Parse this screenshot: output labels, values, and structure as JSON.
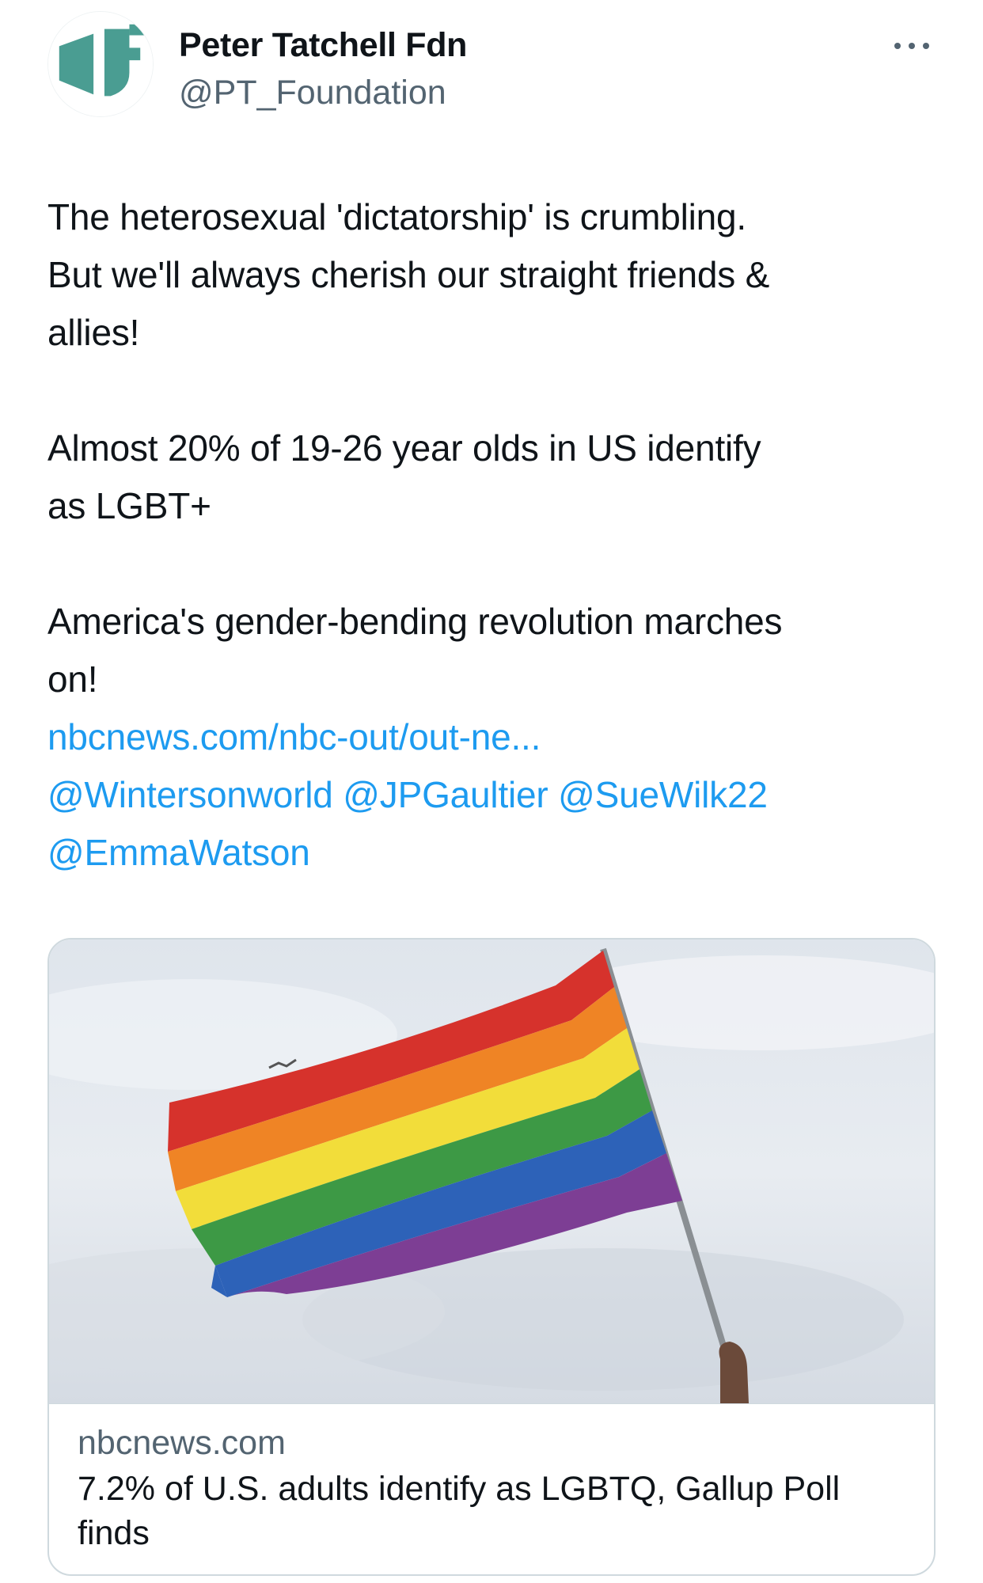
{
  "tweet": {
    "author": {
      "display_name": "Peter Tatchell Fdn",
      "handle": "@PT_Foundation",
      "avatar_icon": "foundation-logo-icon",
      "avatar_color": "#4a9d92"
    },
    "more_icon": "more-horizontal-icon",
    "paragraphs": [
      "The heterosexual 'dictatorship' is crumbling.\nBut we'll always cherish our straight friends &\nallies!",
      "Almost 20% of 19-26 year olds in US identify\nas LGBT+",
      "America's gender-bending revolution marches\non!"
    ],
    "link": "nbcnews.com/nbc-out/out-ne...",
    "mentions": [
      "@Wintersonworld",
      "@JPGaultier",
      "@SueWilk22",
      "@EmmaWatson"
    ],
    "link_color": "#1d9bf0"
  },
  "card": {
    "image_icon": "rainbow-flag-image",
    "domain": "nbcnews.com",
    "title": "7.2% of U.S. adults identify as LGBTQ, Gallup Poll finds"
  }
}
